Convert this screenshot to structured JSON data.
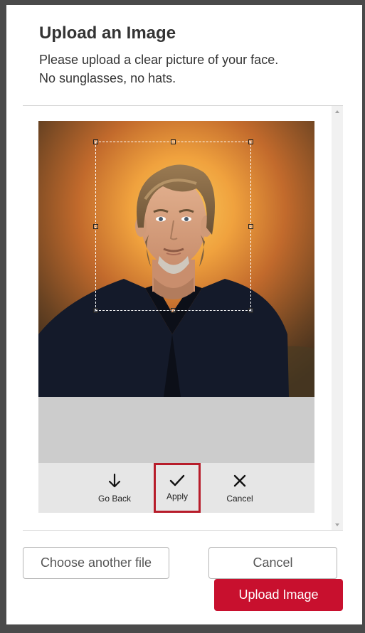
{
  "dialog": {
    "title": "Upload an Image",
    "instructions_line1": "Please upload a clear picture of your face.",
    "instructions_line2": "No sunglasses, no hats."
  },
  "cropper": {
    "photo_alt": "Uploaded portrait photo",
    "toolbar": {
      "go_back_label": "Go Back",
      "go_back_icon": "arrow-down-icon",
      "apply_label": "Apply",
      "apply_icon": "checkmark-icon",
      "cancel_label": "Cancel",
      "cancel_icon": "close-icon"
    }
  },
  "footer": {
    "choose_file_label": "Choose another file",
    "cancel_label": "Cancel",
    "upload_label": "Upload Image"
  },
  "colors": {
    "primary": "#c8102e",
    "highlight_border": "#b71c2a",
    "title_text": "#333333"
  }
}
